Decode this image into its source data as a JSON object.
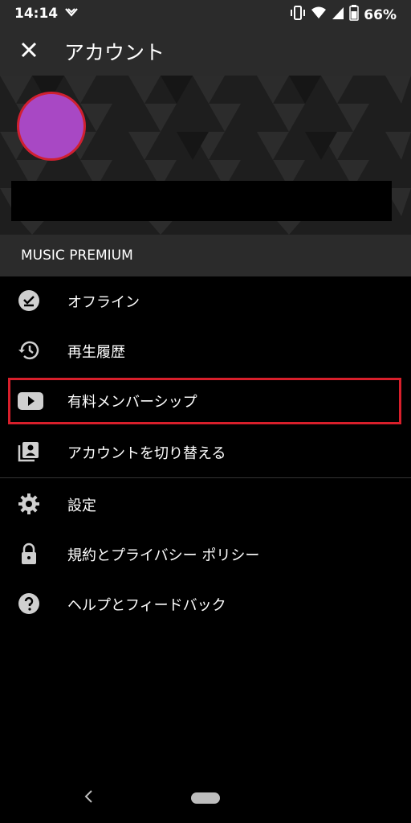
{
  "status_bar": {
    "time": "14:14",
    "battery": "66%",
    "icons": [
      "notification-icon",
      "vibrate-icon",
      "wifi-icon",
      "signal-icon",
      "battery-icon"
    ]
  },
  "app_bar": {
    "close_icon": "close-icon",
    "title": "アカウント"
  },
  "profile": {
    "avatar_color": "#a848c4",
    "avatar_border_color": "#d02030"
  },
  "section": {
    "label": "MUSIC PREMIUM"
  },
  "menu": {
    "items": [
      {
        "icon": "offline-icon",
        "label": "オフライン"
      },
      {
        "icon": "history-icon",
        "label": "再生履歴"
      },
      {
        "icon": "youtube-play-icon",
        "label": "有料メンバーシップ",
        "highlighted": true
      },
      {
        "icon": "switch-account-icon",
        "label": "アカウントを切り替える"
      },
      {
        "icon": "gear-icon",
        "label": "設定"
      },
      {
        "icon": "lock-icon",
        "label": "規約とプライバシー ポリシー"
      },
      {
        "icon": "help-icon",
        "label": "ヘルプとフィードバック"
      }
    ]
  },
  "colors": {
    "background": "#000000",
    "bar": "#2b2b2b",
    "highlight_border": "#d81f2b",
    "icon": "#cfcfcf"
  }
}
